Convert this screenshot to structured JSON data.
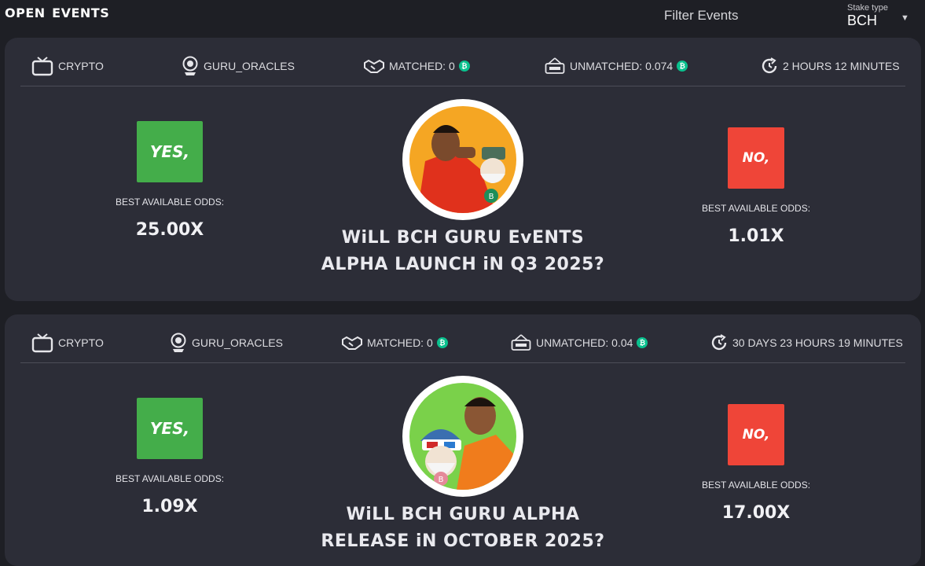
{
  "header": {
    "title": "oPEN EvENTS",
    "filter_label": "Filter Events",
    "stake_type_label": "Stake type",
    "stake_type_value": "BCH",
    "caret": "▼"
  },
  "colors": {
    "background": "#1e1f25",
    "card": "#2c2d37",
    "yes": "#44ad4a",
    "no": "#ef4538",
    "bch_coin": "#0ac18e"
  },
  "events": [
    {
      "category": "CRYPTO",
      "oracle": "GURU_ORACLES",
      "matched": "MATCHED: 0",
      "unmatched": "UNMATCHED: 0.074",
      "time_left": "2 HOURS 12 MINUTES",
      "yes_label": "YES,",
      "no_label": "NO,",
      "yes_odds_label": "BEST AVAILABLE ODDS:",
      "no_odds_label": "BEST AVAILABLE ODDS:",
      "yes_odds": "25.00X",
      "no_odds": "1.01X",
      "question_line1": "WiLL BCH GURU EvENTS",
      "question_line2": "ALPHA LAUNCH iN Q3 2025?",
      "avatar_icon": "drake-reject-meme-image"
    },
    {
      "category": "CRYPTO",
      "oracle": "GURU_ORACLES",
      "matched": "MATCHED: 0",
      "unmatched": "UNMATCHED: 0.04",
      "time_left": "30 DAYS 23 HOURS 19 MINUTES",
      "yes_label": "YES,",
      "no_label": "NO,",
      "yes_odds_label": "BEST AVAILABLE ODDS:",
      "no_odds_label": "BEST AVAILABLE ODDS:",
      "yes_odds": "1.09X",
      "no_odds": "17.00X",
      "question_line1": "WiLL BCH GURU ALPHA",
      "question_line2": "RELEASE iN OCTOBER 2025?",
      "avatar_icon": "drake-approve-meme-image"
    }
  ],
  "icons": {
    "category": "tv-icon",
    "oracle": "crystal-ball-icon",
    "matched": "handshake-icon",
    "unmatched": "open-sign-icon",
    "time": "clock-refresh-icon",
    "coin": "bch-coin-icon"
  },
  "coin_symbol": "₿"
}
